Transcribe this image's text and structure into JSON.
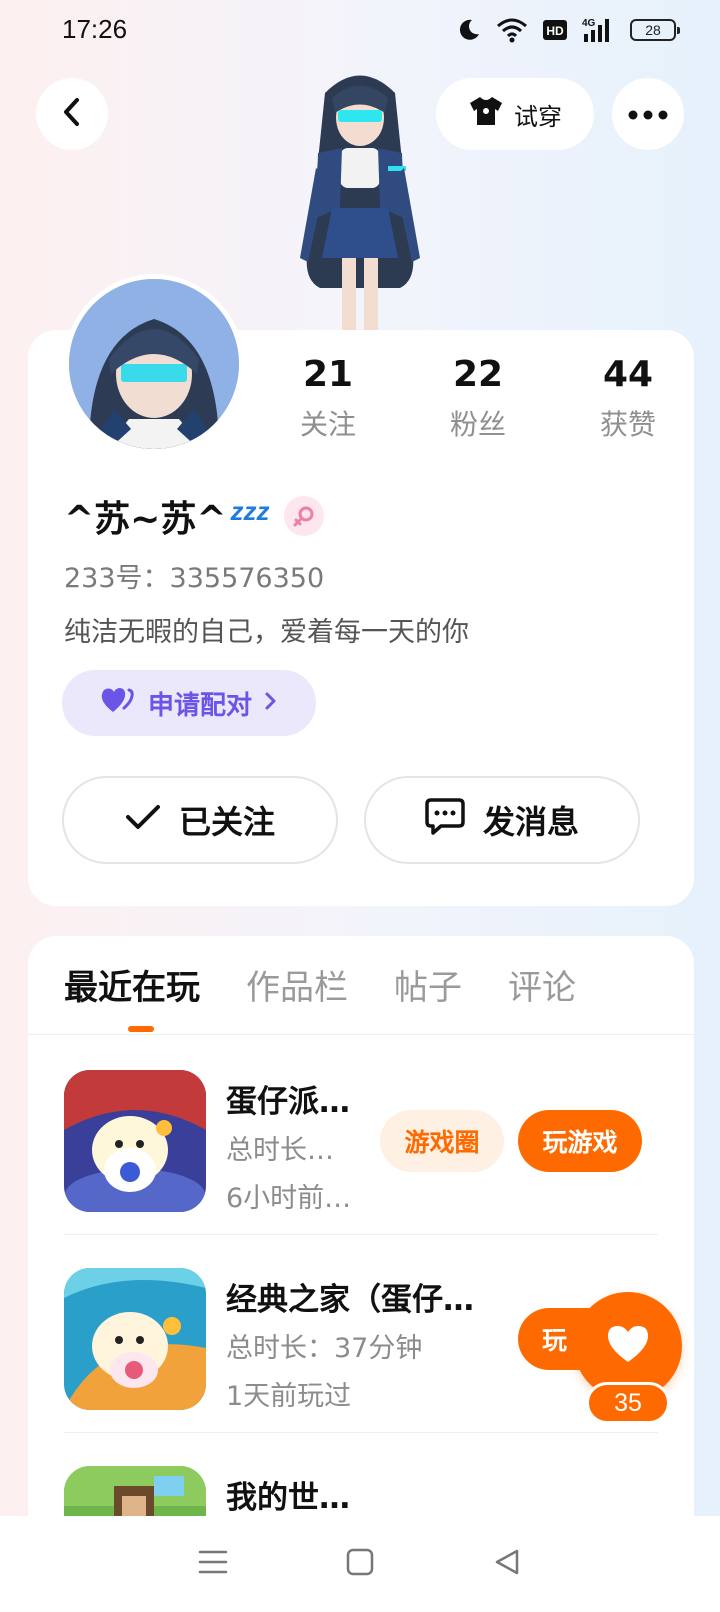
{
  "status_bar": {
    "time": "17:26",
    "battery": "28",
    "network": "4G",
    "hd": "HD"
  },
  "header": {
    "tryon_label": "试穿"
  },
  "profile": {
    "stats": [
      {
        "value": "21",
        "label": "关注"
      },
      {
        "value": "22",
        "label": "粉丝"
      },
      {
        "value": "44",
        "label": "获赞"
      }
    ],
    "nickname": "^苏~苏^",
    "nickname_suffix": "zzz",
    "user_id": "233号：335576350",
    "bio": "纯洁无暇的自己，爱着每一天的你",
    "pair_label": "申请配对",
    "follow_label": "已关注",
    "message_label": "发消息"
  },
  "tabs": [
    {
      "label": "最近在玩",
      "active": true
    },
    {
      "label": "作品栏",
      "active": false
    },
    {
      "label": "帖子",
      "active": false
    },
    {
      "label": "评论",
      "active": false
    }
  ],
  "games": [
    {
      "title": "蛋仔派…",
      "sub1": "总时长…",
      "sub2": "6小时前…",
      "circle_label": "游戏圈",
      "play_label": "玩游戏"
    },
    {
      "title": "经典之家（蛋仔…",
      "sub1": "总时长：37分钟",
      "sub2": "1天前玩过",
      "circle_label": "",
      "play_label": "玩"
    },
    {
      "title": "我的世…",
      "sub1": "",
      "sub2": "",
      "circle_label": "",
      "play_label": ""
    }
  ],
  "like_count": "35",
  "colors": {
    "accent": "#ff6a00",
    "pair": "#6a55e6"
  }
}
